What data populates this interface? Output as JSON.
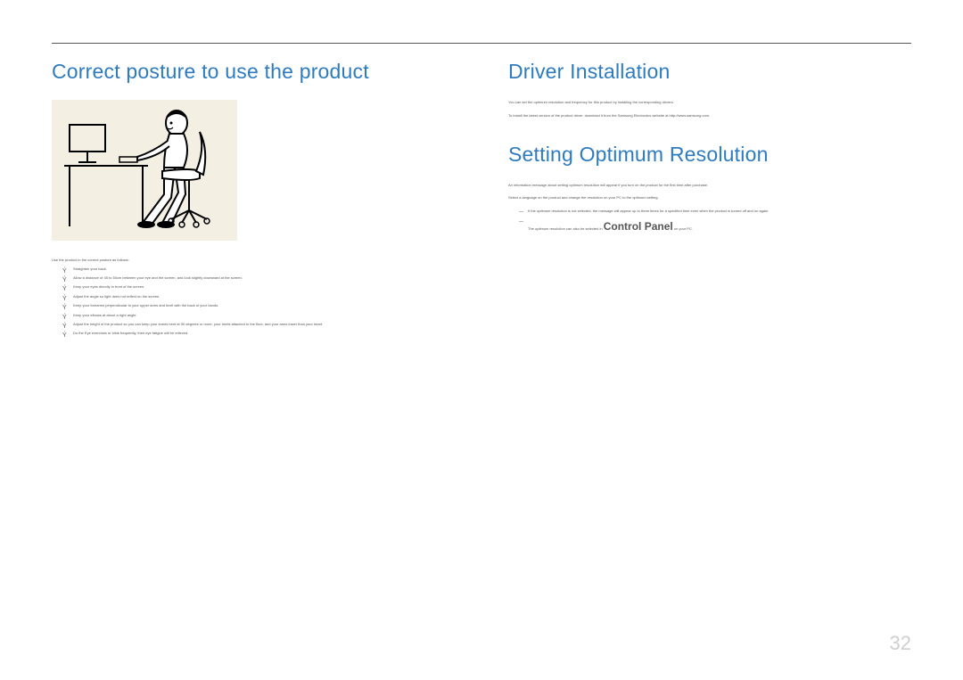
{
  "left": {
    "heading": "Correct posture to use the product",
    "intro": "Use the product in the correct posture as follows:",
    "bullets": [
      "Straighten your back.",
      "Allow a distance of 45 to 50cm between your eye and the screen, and look slightly downward at the screen.",
      "Keep your eyes directly in front of the screen.",
      "Adjust the angle so light does not reflect on the screen.",
      "Keep your forearms perpendicular to your upper arms and level with the back of your hands.",
      "Keep your elbows at about a right angle.",
      "Adjust the height of the product so you can keep your knees bent at 90 degrees or more, your heels attached to the floor, and your arms lower than your heart.",
      "Do the Eye exercises or blink frequently, then eye fatigue will be relieved."
    ]
  },
  "right": {
    "heading_driver": "Driver Installation",
    "driver_paras": [
      "You can set the optimum resolution and frequency for this product by installing the corresponding drivers.",
      "To install the latest version of the product driver, download it from the Samsung Electronics website at http://www.samsung.com."
    ],
    "heading_resolution": "Setting Optimum Resolution",
    "resolution_paras": [
      "An information message about setting optimum resolution will appear if you turn on the product for the first time after purchase.",
      "Select a language on the product and change the resolution on your PC to the optimum setting."
    ],
    "notes_prefix": [
      "If the optimum resolution is not selected, the message will appear up to three times for a specified time even when the product is turned off and on again.",
      "The optimum resolution can also be selected in "
    ],
    "control_panel": "Control Panel",
    "notes_suffix": " on your PC."
  },
  "pagenum": "32"
}
